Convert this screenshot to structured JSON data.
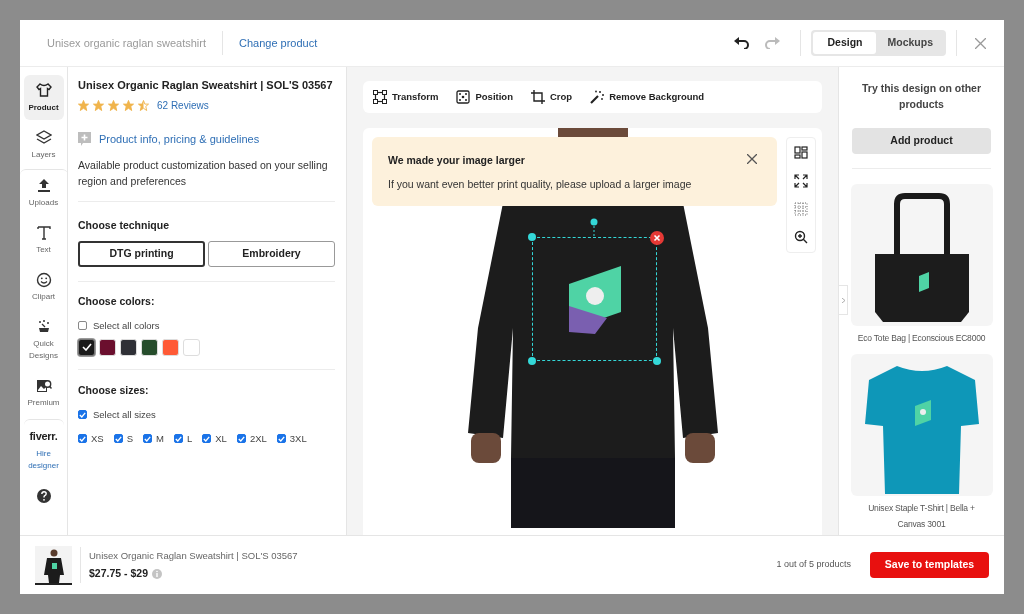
{
  "header": {
    "product_name": "Unisex organic raglan sweatshirt",
    "change_link": "Change product",
    "view_tabs": [
      {
        "label": "Design",
        "selected": true
      },
      {
        "label": "Mockups",
        "selected": false
      }
    ]
  },
  "rail": [
    {
      "label": "Product",
      "kind": "tshirt",
      "selected": true
    },
    {
      "label": "Layers",
      "kind": "layers",
      "selected": false
    },
    {
      "label": "Uploads",
      "kind": "upload",
      "selected": false
    },
    {
      "label": "Text",
      "kind": "text",
      "selected": false
    },
    {
      "label": "Clipart",
      "kind": "smile",
      "selected": false
    },
    {
      "label": "Quick Designs",
      "kind": "magic",
      "selected": false
    },
    {
      "label": "Premium",
      "kind": "premium",
      "selected": false
    },
    {
      "label": "Hire designer",
      "kind": "fiverr",
      "brand": "fiverr.",
      "selected": false
    },
    {
      "kind": "help",
      "selected": false
    }
  ],
  "panel": {
    "title": "Unisex Organic Raglan Sweatshirt | SOL'S 03567",
    "stars": 4.5,
    "reviews": "62 Reviews",
    "info_link": "Product info, pricing & guidelines",
    "description": "Available product customization based on your selling region and preferences",
    "technique_heading": "Choose technique",
    "techniques": [
      {
        "label": "DTG printing",
        "selected": true
      },
      {
        "label": "Embroidery",
        "selected": false
      }
    ],
    "colors_heading": "Choose colors:",
    "select_all_colors": {
      "label": "Select all colors",
      "checked": false
    },
    "colors": [
      {
        "color": "#1a1a1a",
        "selected": true
      },
      {
        "color": "#6b0f2e",
        "selected": false
      },
      {
        "color": "#2f3036",
        "selected": false
      },
      {
        "color": "#264d2c",
        "selected": false
      },
      {
        "color": "#ff5a36",
        "selected": false
      },
      {
        "color": "#ffffff",
        "selected": false
      }
    ],
    "sizes_heading": "Choose sizes:",
    "select_all_sizes": {
      "label": "Select all sizes",
      "checked": true
    },
    "sizes": [
      {
        "label": "XS",
        "checked": true
      },
      {
        "label": "S",
        "checked": true
      },
      {
        "label": "M",
        "checked": true
      },
      {
        "label": "L",
        "checked": true
      },
      {
        "label": "XL",
        "checked": true
      },
      {
        "label": "2XL",
        "checked": true
      },
      {
        "label": "3XL",
        "checked": true
      }
    ]
  },
  "toolbar": [
    {
      "label": "Transform",
      "kind": "transform"
    },
    {
      "label": "Position",
      "kind": "position"
    },
    {
      "label": "Crop",
      "kind": "crop"
    },
    {
      "label": "Remove Background",
      "kind": "wand"
    }
  ],
  "notice": {
    "title": "We made your image larger",
    "message": "If you want even better print quality, please upload a larger image"
  },
  "side_tools": [
    {
      "kind": "grid"
    },
    {
      "kind": "expand"
    },
    {
      "kind": "dots"
    },
    {
      "kind": "zoom"
    }
  ],
  "other_products": {
    "heading": "Try this design on other products",
    "add_button": "Add product",
    "items": [
      {
        "name": "Eco Tote Bag | Econscious EC8000",
        "kind": "tote"
      },
      {
        "name": "Unisex Staple T-Shirt | Bella + Canvas 3001",
        "kind": "tee"
      }
    ]
  },
  "footer": {
    "product_name": "Unisex Organic Raglan Sweatshirt | SOL'S 03567",
    "price": "$27.75 - $29",
    "count": "1 out of 5 products",
    "save_button": "Save to templates"
  }
}
